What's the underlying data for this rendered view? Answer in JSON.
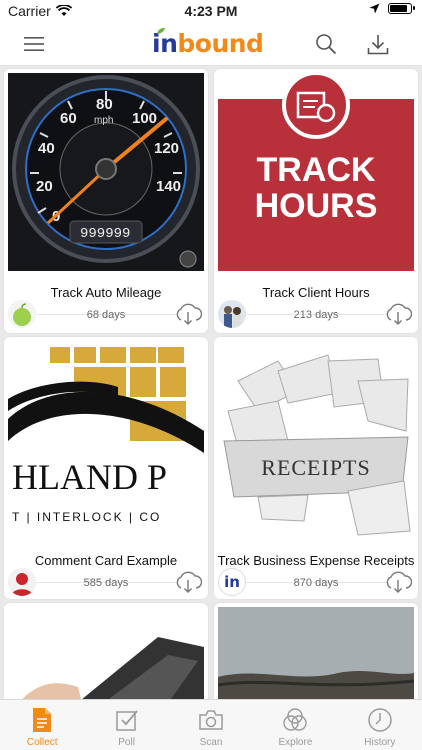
{
  "status_bar": {
    "carrier": "Carrier",
    "time": "4:23 PM"
  },
  "nav": {
    "logo_in": "in",
    "logo_bound": "bound"
  },
  "cards": [
    {
      "title": "Track Auto Mileage",
      "days": "68 days",
      "thumb_odometer": "999999",
      "speed_labels": [
        "0",
        "20",
        "40",
        "60",
        "80",
        "100",
        "120",
        "140"
      ],
      "unit": "mph"
    },
    {
      "title": "Track Client Hours",
      "days": "213 days",
      "thumb_text_1": "TRACK",
      "thumb_text_2": "HOURS"
    },
    {
      "title": "Comment Card Example",
      "days": "585 days",
      "thumb_text_1": "HLAND P",
      "thumb_text_2": "T | INTERLOCK | CO"
    },
    {
      "title": "Track Business Expense Receipts",
      "days": "870 days",
      "thumb_text_1": "RECEIPTS",
      "avatar_text": "in"
    },
    {
      "title": "",
      "days": ""
    },
    {
      "title": "",
      "days": ""
    }
  ],
  "tabs": [
    {
      "label": "Collect",
      "icon": "document-icon",
      "active": true
    },
    {
      "label": "Poll",
      "icon": "poll-icon",
      "active": false
    },
    {
      "label": "Scan",
      "icon": "camera-icon",
      "active": false
    },
    {
      "label": "Explore",
      "icon": "explore-icon",
      "active": false
    },
    {
      "label": "History",
      "icon": "history-icon",
      "active": false
    }
  ],
  "colors": {
    "accent": "#f28a1a",
    "logo_blue": "#243b9a",
    "track_red": "#b8313a"
  }
}
